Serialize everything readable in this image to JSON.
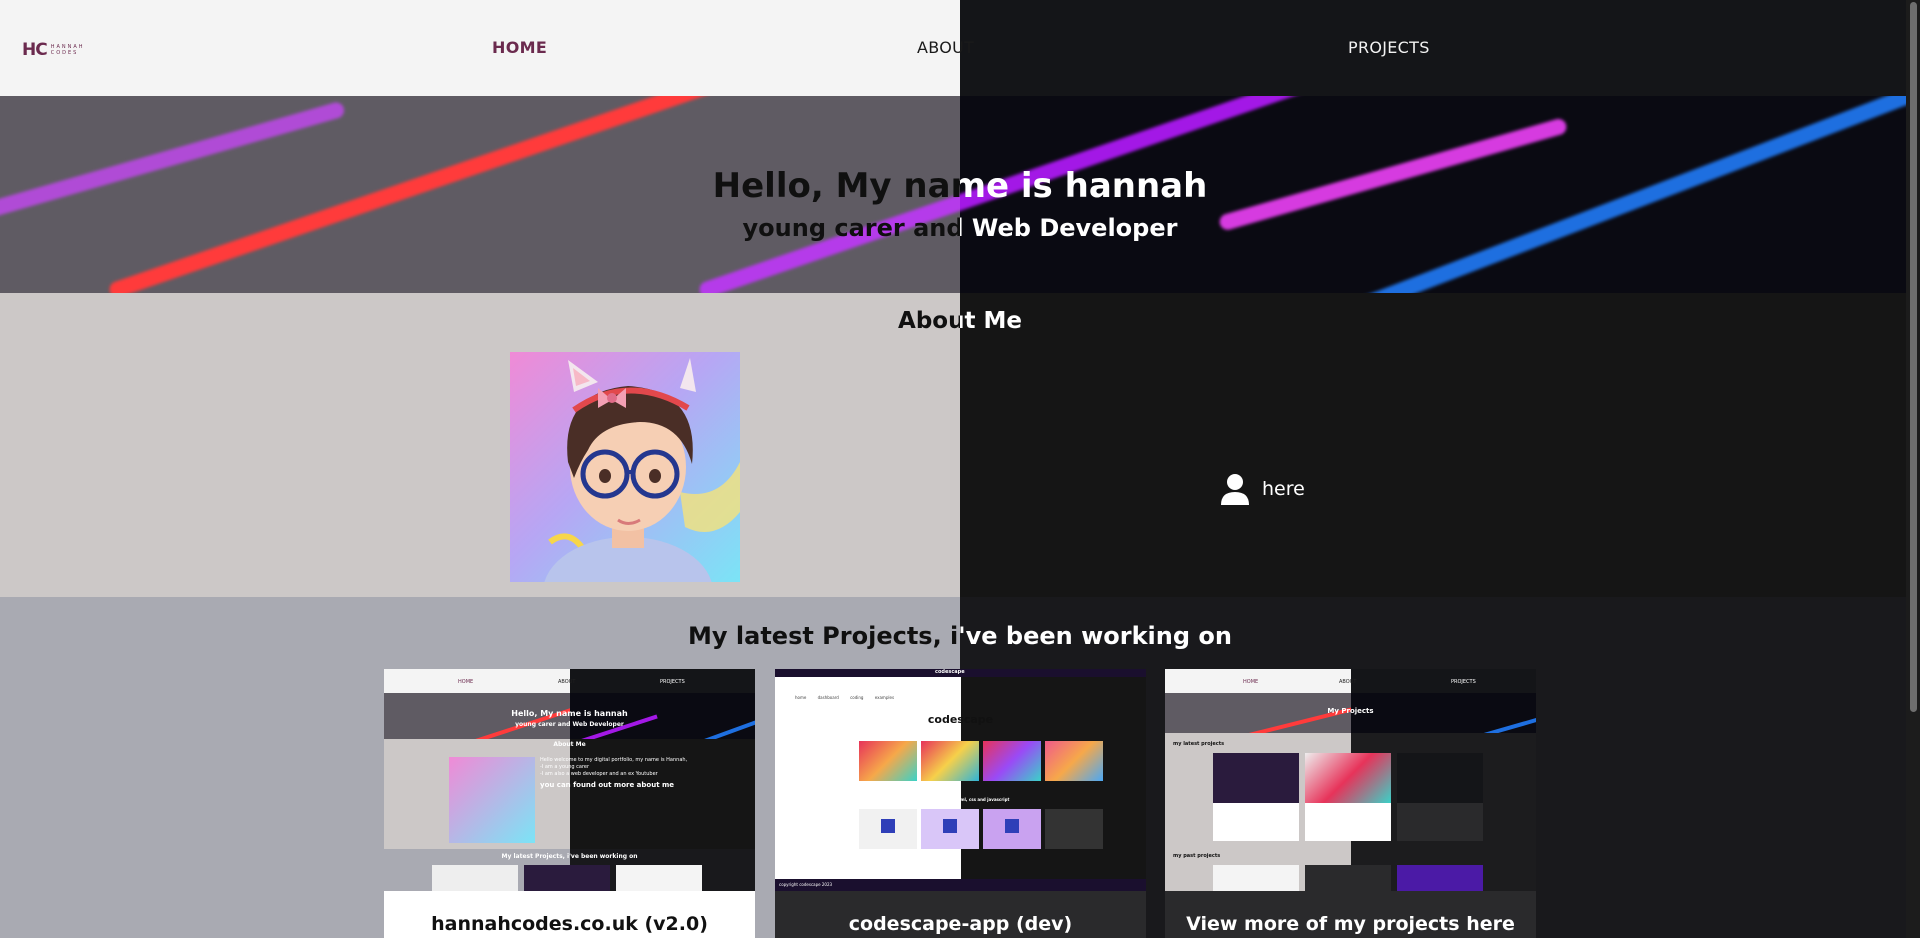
{
  "nav": {
    "logo": {
      "initials": "HC",
      "line1": "HANNAH",
      "line2": "CODES"
    },
    "links": [
      "HOME",
      "ABOUT",
      "PROJECTS"
    ]
  },
  "hero": {
    "title": "Hello, My name is hannah",
    "subtitle": "young carer and Web Developer"
  },
  "about": {
    "title": "About Me",
    "lines": [
      "Hello welcome to my digital portfolio, my name is Hannah,",
      "-I am a young carer",
      "-I am also a web developer and an ex Youtuber"
    ],
    "more": "you can found out more about me",
    "here_link": "here",
    "icon": "user-icon"
  },
  "projects": {
    "title": "My latest Projects, i've been working on",
    "cards": [
      {
        "label": "hannahcodes.co.uk (v2.0)",
        "shot": "portfolio-screenshot"
      },
      {
        "label": "codescape-app (dev)",
        "shot": "codescape-screenshot"
      },
      {
        "label": "View more of my projects here",
        "shot": "projects-page-screenshot"
      }
    ],
    "mini": {
      "nav": [
        "HOME",
        "ABOUT",
        "PROJECTS"
      ],
      "codescape_brand": "codescape",
      "codescape_tagline": "codescape",
      "codescape_tabs": [
        "home",
        "dashboard",
        "coding examples"
      ],
      "codescape_section": "beginners guide to html, css and javascript",
      "codescape_footer": "copyright codescape 2023",
      "projects_title": "My Projects",
      "projects_latest": "my latest projects",
      "projects_past": "my past projects"
    }
  },
  "colors": {
    "brand": "#6b2a4e",
    "light_nav": "#f4f4f4",
    "dark_nav": "#141518",
    "about_light": "#ccc8c7",
    "about_dark": "#151515",
    "projects_light": "#a9aab2",
    "projects_dark": "#19191c"
  }
}
